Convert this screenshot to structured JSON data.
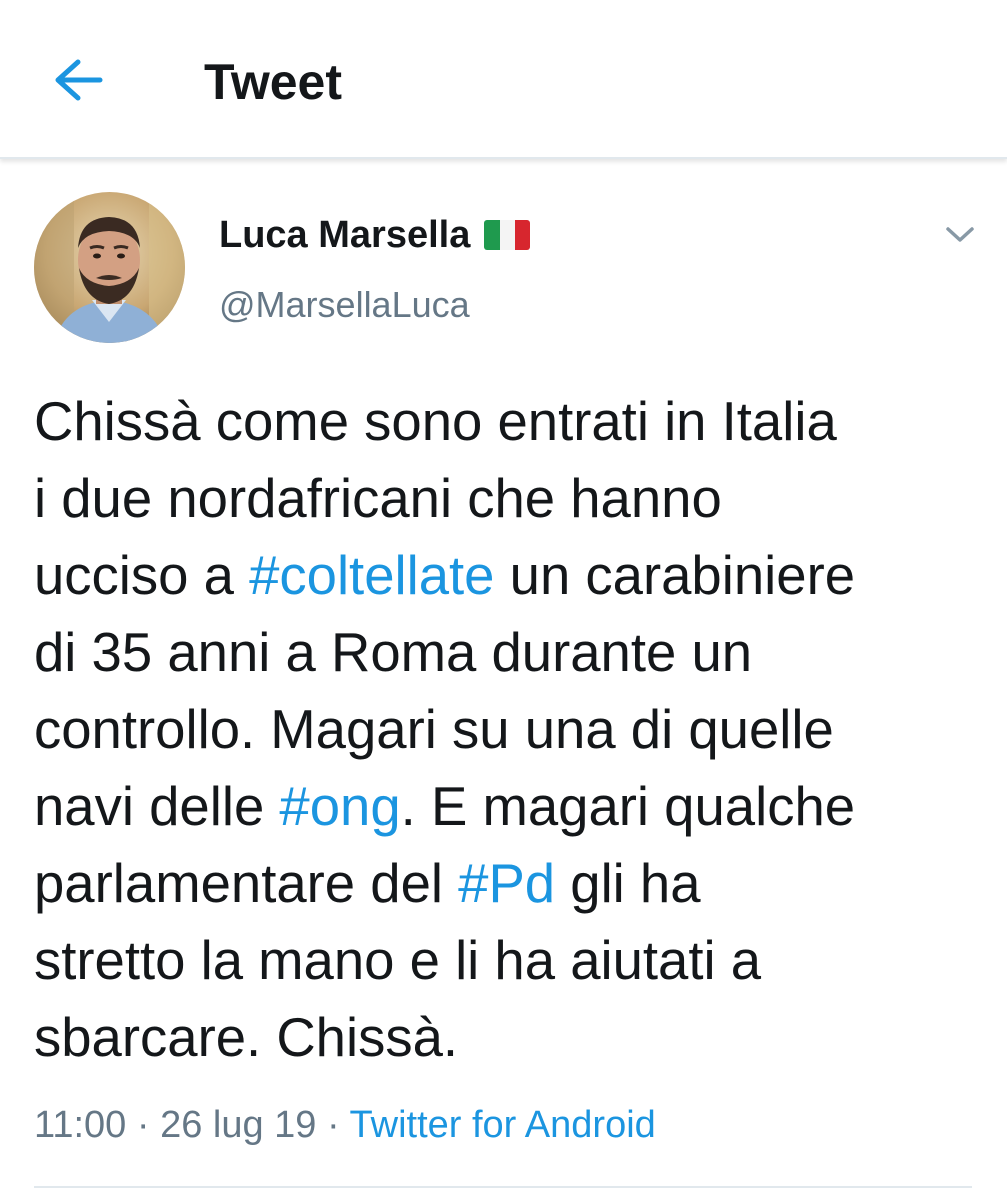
{
  "header": {
    "title": "Tweet",
    "back_icon": "arrow-left-icon",
    "accent_color": "#1b95e0"
  },
  "author": {
    "display_name": "Luca Marsella",
    "flag_icon": "italy-flag-icon",
    "handle": "@MarsellaLuca",
    "avatar_icon": "avatar"
  },
  "menu": {
    "caret_icon": "chevron-down-icon"
  },
  "tweet": {
    "lines": [
      [
        "Chissà come sono entrati in Italia"
      ],
      [
        "i due nordafricani che hanno"
      ],
      [
        "ucciso a ",
        "#coltellate",
        " un carabiniere"
      ],
      [
        "di 35 anni a Roma durante un"
      ],
      [
        "controllo. Magari su una di quelle"
      ],
      [
        "navi delle ",
        "#ong",
        ". E magari qualche"
      ],
      [
        "parlamentare del ",
        "#Pd",
        " gli ha"
      ],
      [
        "stretto la mano e li ha aiutati a"
      ],
      [
        "sbarcare. Chissà."
      ]
    ]
  },
  "meta": {
    "time": "11:00",
    "separator": " · ",
    "date": "26 lug 19",
    "source": "Twitter for Android"
  }
}
